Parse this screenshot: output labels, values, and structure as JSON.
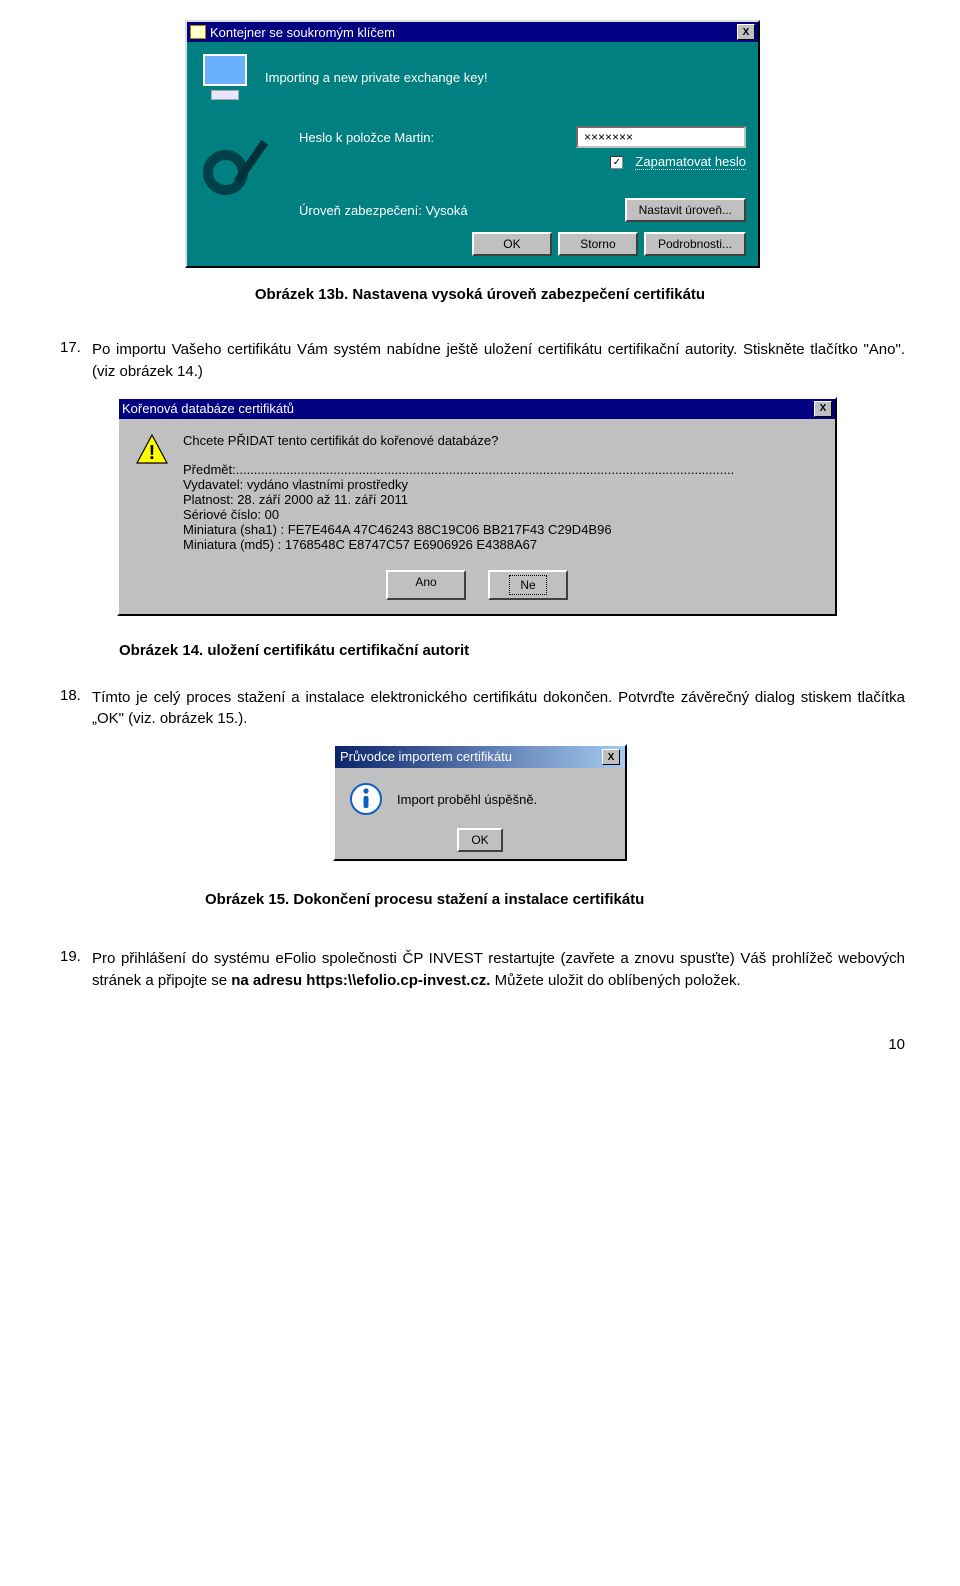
{
  "win1": {
    "title": "Kontejner se soukromým klíčem",
    "close_x": "X",
    "importing": "Importing a new private exchange key!",
    "password_label": "Heslo k položce Martin:",
    "password_value": "×××××××",
    "remember_checked": "✓",
    "remember_label": "Zapamatovat heslo",
    "security_label": "Úroveň zabezpečení: Vysoká",
    "set_level_btn": "Nastavit úroveň...",
    "ok": "OK",
    "cancel": "Storno",
    "details": "Podrobnosti..."
  },
  "figcap1": "Obrázek 13b. Nastavena vysoká úroveň zabezpečení certifikátu",
  "item17": {
    "num": "17.",
    "text": "Po importu Vašeho certifikátu Vám systém nabídne ještě uložení certifikátu certifikační autority. Stiskněte tlačítko \"Ano\". (viz obrázek 14.)"
  },
  "win2": {
    "title": "Kořenová databáze certifikátů",
    "close_x": "X",
    "line1": "Chcete PŘIDAT tento certifikát do kořenové databáze?",
    "pred": "Předmět:",
    "dots": "..........................................................................................................................................",
    "l2": "Vydavatel: vydáno vlastními prostředky",
    "l3": "Platnost: 28. září 2000 až 11. září 2011",
    "l4": "Sériové číslo: 00",
    "l5": "Miniatura (sha1) : FE7E464A 47C46243 88C19C06 BB217F43 C29D4B96",
    "l6": "Miniatura (md5) : 1768548C E8747C57 E6906926 E4388A67",
    "yes": "Ano",
    "no": "Ne"
  },
  "figcap2": "Obrázek 14. uložení certifikátu certifikační autorit",
  "item18": {
    "num": "18.",
    "text": "Tímto je celý proces stažení a instalace elektronického certifikátu dokončen. Potvrďte závěrečný dialog stiskem tlačítka „OK\" (viz. obrázek 15.)."
  },
  "sdlg": {
    "title": "Průvodce importem certifikátu",
    "close_x": "X",
    "msg": "Import proběhl úspěšně.",
    "ok": "OK"
  },
  "figcap3": "Obrázek 15. Dokončení procesu stažení a instalace certifikátu",
  "item19": {
    "num": "19.",
    "t1": "Pro přihlášení do systému eFolio společnosti ČP INVEST restartujte (zavřete a znovu spusťte) Váš prohlížeč webových stránek a připojte se ",
    "t2": "na adresu https:\\\\efolio.cp-invest.cz.",
    "t3": " Můžete uložit do oblíbených položek."
  },
  "page": "10"
}
